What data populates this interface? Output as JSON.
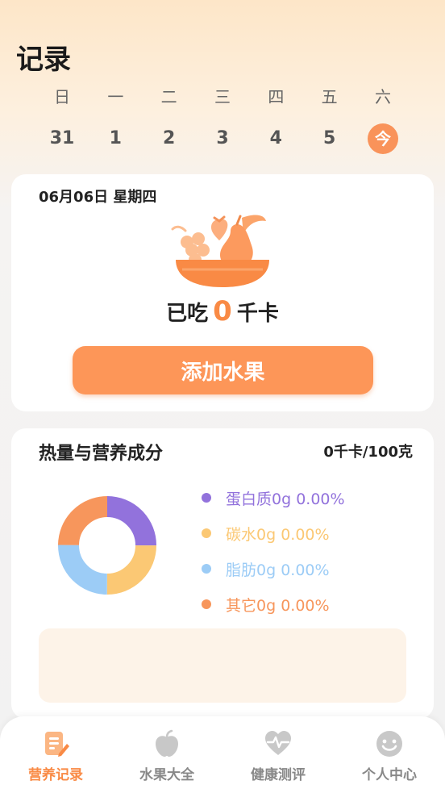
{
  "header": {
    "title": "记录"
  },
  "calendar": {
    "weekdays": [
      "日",
      "一",
      "二",
      "三",
      "四",
      "五",
      "六"
    ],
    "days": [
      "31",
      "1",
      "2",
      "3",
      "4",
      "5",
      "今"
    ]
  },
  "summary": {
    "date": "06月06日 星期四",
    "eaten_prefix": "已吃",
    "eaten_value": "0",
    "eaten_unit": "千卡",
    "add_button": "添加水果"
  },
  "nutrition": {
    "title": "热量与营养成分",
    "total": "0千卡/100克",
    "items": [
      {
        "label": "蛋白质0g 0.00%",
        "color": "#9272dc",
        "fraction": 0.25
      },
      {
        "label": "碳水0g 0.00%",
        "color": "#fbc874",
        "fraction": 0.25
      },
      {
        "label": "脂肪0g 0.00%",
        "color": "#9cccf6",
        "fraction": 0.25
      },
      {
        "label": "其它0g 0.00%",
        "color": "#f7965c",
        "fraction": 0.25
      }
    ]
  },
  "tabbar": {
    "tabs": [
      {
        "label": "营养记录",
        "icon": "note-edit-icon",
        "active": true
      },
      {
        "label": "水果大全",
        "icon": "apple-icon",
        "active": false
      },
      {
        "label": "健康测评",
        "icon": "heart-pulse-icon",
        "active": false
      },
      {
        "label": "个人中心",
        "icon": "smile-face-icon",
        "active": false
      }
    ]
  },
  "colors": {
    "accent": "#f98a45",
    "button": "#fd9658",
    "inactive": "#c8c8c8"
  }
}
